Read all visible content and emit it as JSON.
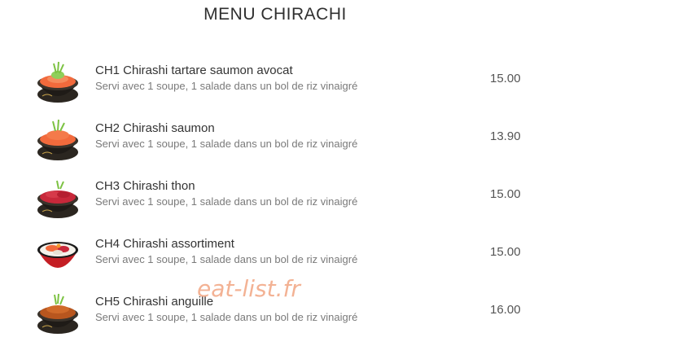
{
  "menu": {
    "title": "MENU CHIRACHI",
    "items": [
      {
        "name": "CH1 Chirashi tartare saumon avocat",
        "description": "Servi avec 1 soupe, 1 salade dans un bol de riz vinaigré",
        "price": "15.00",
        "image": "chirashi-salmon-avocado-bowl"
      },
      {
        "name": "CH2 Chirashi saumon",
        "description": "Servi avec 1 soupe, 1 salade dans un bol de riz vinaigré",
        "price": "13.90",
        "image": "chirashi-salmon-bowl"
      },
      {
        "name": "CH3 Chirashi thon",
        "description": "Servi avec 1 soupe, 1 salade dans un bol de riz vinaigré",
        "price": "15.00",
        "image": "chirashi-tuna-bowl"
      },
      {
        "name": "CH4 Chirashi assortiment",
        "description": "Servi avec 1 soupe, 1 salade dans un bol de riz vinaigré",
        "price": "15.00",
        "image": "chirashi-assortment-bowl"
      },
      {
        "name": "CH5 Chirashi anguille",
        "description": "Servi avec 1 soupe, 1 salade dans un bol de riz vinaigré",
        "price": "16.00",
        "image": "chirashi-eel-bowl"
      }
    ]
  },
  "watermark": "eat-list.fr",
  "colors": {
    "salmon": "#f26a3c",
    "tuna": "#c8283a",
    "eel": "#b8561e",
    "bowl": "#2b2620",
    "garnish": "#7cc242",
    "watermark": "#f2a582"
  }
}
